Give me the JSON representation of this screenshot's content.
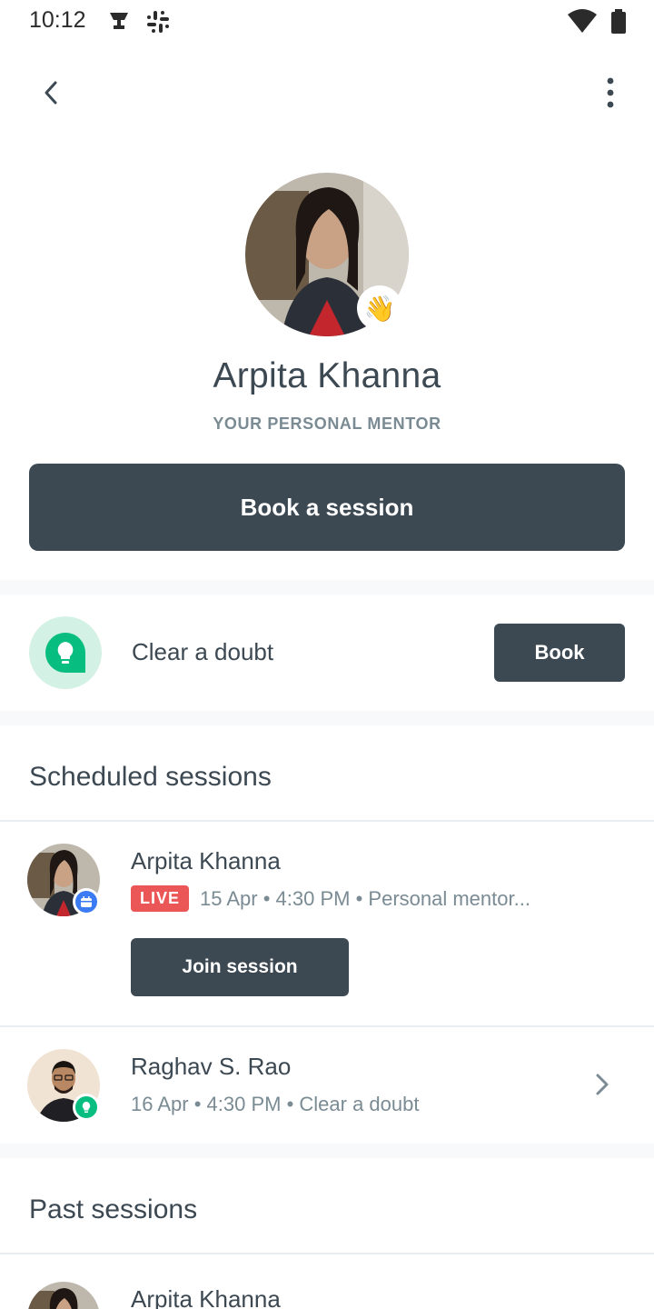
{
  "status_bar": {
    "time": "10:12",
    "icons": [
      "trophy-icon",
      "slack-icon",
      "wifi-icon",
      "battery-icon"
    ]
  },
  "app_bar": {
    "back_icon": "chevron-left-icon",
    "more_icon": "more-vertical-icon"
  },
  "profile": {
    "name": "Arpita Khanna",
    "role": "YOUR PERSONAL MENTOR",
    "badge_emoji": "👋"
  },
  "book_session": {
    "label": "Book a session"
  },
  "clear_doubt": {
    "label": "Clear a doubt",
    "button_label": "Book",
    "icon": "lightbulb-chat-icon"
  },
  "scheduled": {
    "title": "Scheduled sessions",
    "items": [
      {
        "name": "Arpita Khanna",
        "live_label": "LIVE",
        "meta": "15 Apr • 4:30 PM • Personal mentor...",
        "join_label": "Join session",
        "badge_icon": "calendar-icon"
      },
      {
        "name": "Raghav S. Rao",
        "meta": "16 Apr • 4:30 PM • Clear a doubt",
        "badge_icon": "lightbulb-icon"
      }
    ]
  },
  "past": {
    "title": "Past sessions",
    "items": [
      {
        "name": "Arpita Khanna"
      }
    ]
  },
  "colors": {
    "primary_dark": "#3c4852",
    "live_red": "#eb5757",
    "doubt_green": "#08bd80",
    "doubt_bg": "#d4f1e6",
    "muted_text": "#7a8b94"
  }
}
